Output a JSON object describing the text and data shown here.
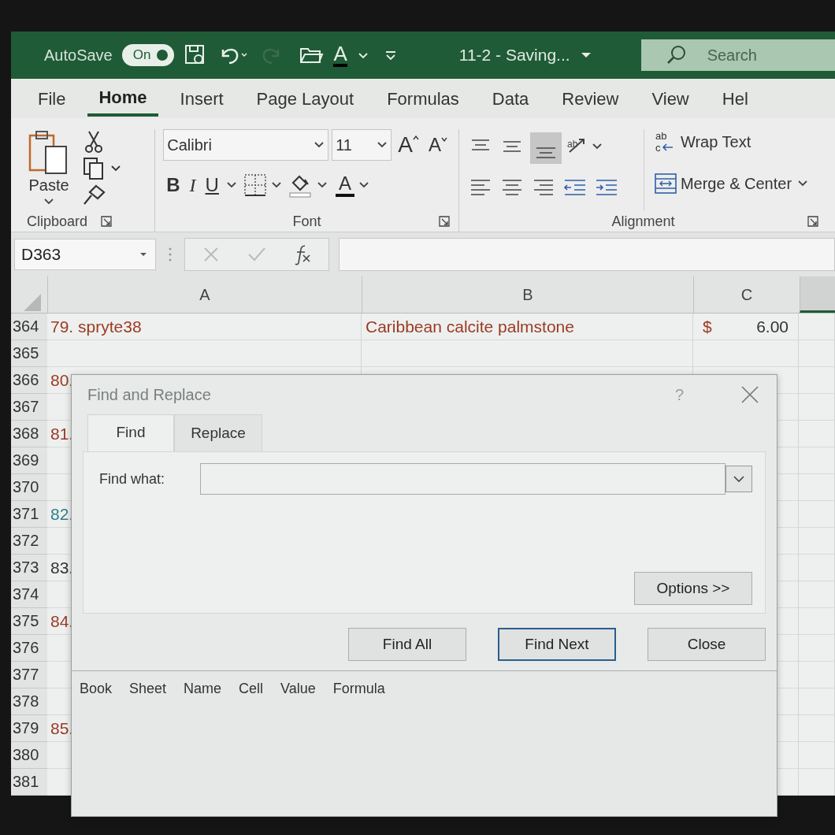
{
  "title_bar": {
    "autosave_label": "AutoSave",
    "autosave_state": "On",
    "autosave_on": true,
    "font_color_letter": "A",
    "document_title": "11-2  -  Saving...",
    "search_placeholder": "Search"
  },
  "ribbon_tabs": [
    {
      "label": "File",
      "selected": false
    },
    {
      "label": "Home",
      "selected": true
    },
    {
      "label": "Insert",
      "selected": false
    },
    {
      "label": "Page Layout",
      "selected": false
    },
    {
      "label": "Formulas",
      "selected": false
    },
    {
      "label": "Data",
      "selected": false
    },
    {
      "label": "Review",
      "selected": false
    },
    {
      "label": "View",
      "selected": false
    },
    {
      "label": "Hel",
      "selected": false
    }
  ],
  "ribbon": {
    "clipboard": {
      "paste": "Paste",
      "label": "Clipboard"
    },
    "font": {
      "font_name": "Calibri",
      "font_size": "11",
      "grow": "A",
      "shrink": "A",
      "bold": "B",
      "italic": "I",
      "underline": "U",
      "font_color": "A",
      "label": "Font"
    },
    "alignment": {
      "orientation_letters": "ab",
      "wrap_letters": [
        "ab",
        "c"
      ],
      "wrap_text": "Wrap Text",
      "merge_center": "Merge & Center",
      "label": "Alignment"
    }
  },
  "formula_bar": {
    "name_box": "D363"
  },
  "sheet": {
    "columns": [
      "A",
      "B",
      "C"
    ],
    "rows": [
      {
        "number": "364",
        "a": "79. spryte38",
        "color": "#9b3a22",
        "b": "Caribbean calcite palmstone",
        "c_symbol": "$",
        "c_value": "6.00"
      },
      {
        "number": "365"
      },
      {
        "number": "366",
        "a": "80.",
        "color": "#9b3a22"
      },
      {
        "number": "367"
      },
      {
        "number": "368",
        "a": "81.",
        "color": "#9b3a22"
      },
      {
        "number": "369"
      },
      {
        "number": "370"
      },
      {
        "number": "371",
        "a": "82.",
        "color": "#2f7f8a"
      },
      {
        "number": "372"
      },
      {
        "number": "373",
        "a": "83.",
        "color": "#333333"
      },
      {
        "number": "374"
      },
      {
        "number": "375",
        "a": "84.",
        "color": "#9b3a22"
      },
      {
        "number": "376"
      },
      {
        "number": "377"
      },
      {
        "number": "378"
      },
      {
        "number": "379",
        "a": "85.",
        "color": "#9b3a22"
      },
      {
        "number": "380"
      },
      {
        "number": "381"
      }
    ]
  },
  "dialog": {
    "title": "Find and Replace",
    "help": "?",
    "tabs": [
      {
        "label": "Find",
        "selected": true
      },
      {
        "label": "Replace",
        "selected": false
      }
    ],
    "find_label": "Find what:",
    "buttons": [
      {
        "label": "Options >>",
        "kind": "options",
        "default": false
      },
      {
        "label": "Find All",
        "kind": "action",
        "default": false
      },
      {
        "label": "Find Next",
        "kind": "action",
        "default": true
      },
      {
        "label": "Close",
        "kind": "action",
        "default": false
      }
    ],
    "result_columns": [
      "Book",
      "Sheet",
      "Name",
      "Cell",
      "Value",
      "Formula"
    ]
  }
}
